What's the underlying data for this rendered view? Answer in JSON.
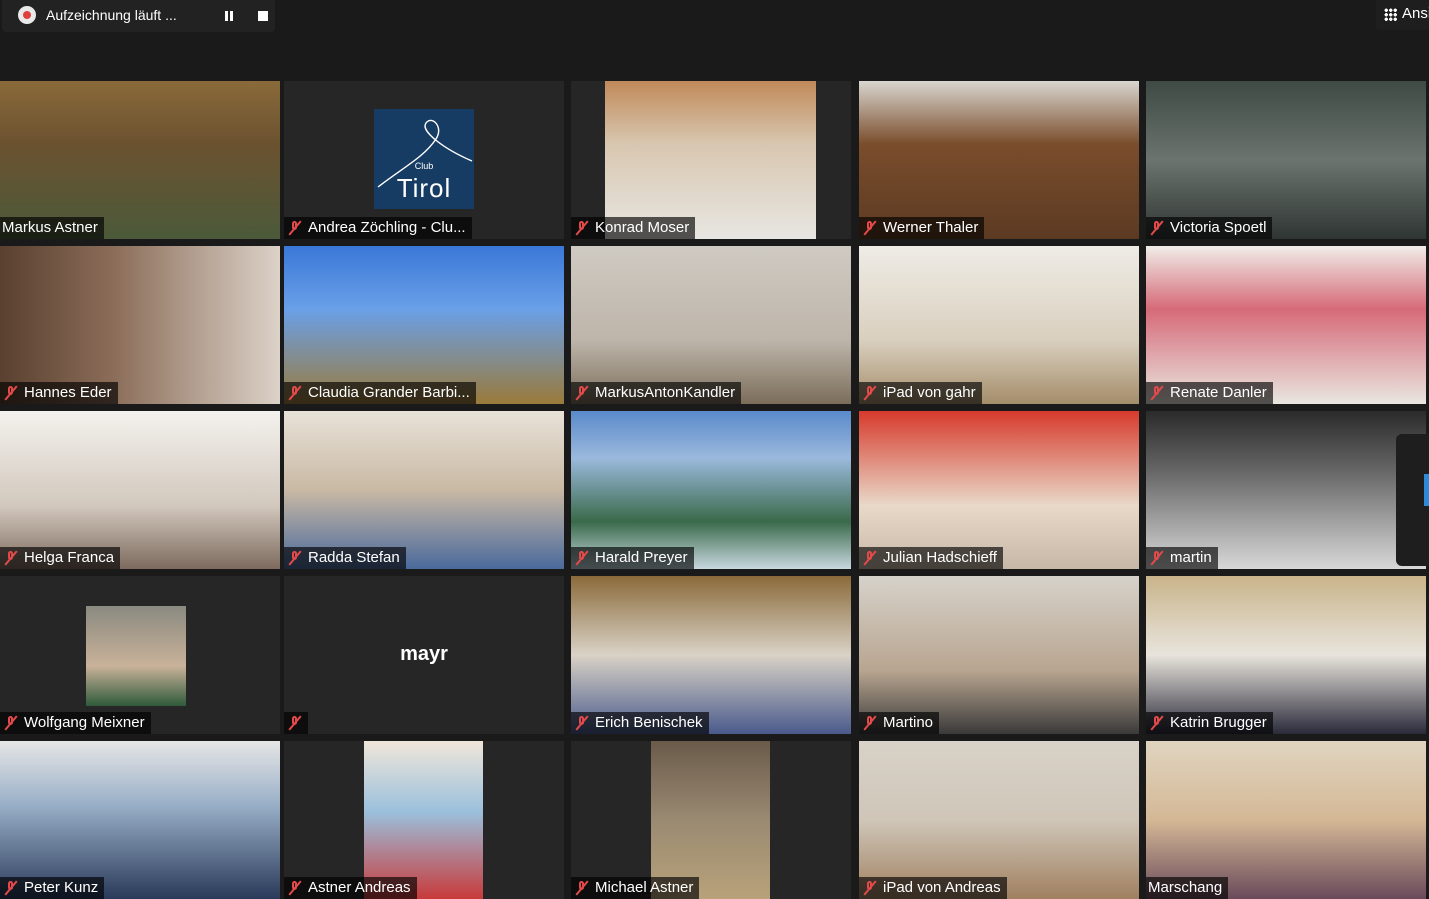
{
  "recording": {
    "label": "Aufzeichnung läuft ...",
    "pause_icon": "pause-icon",
    "stop_icon": "stop-icon"
  },
  "view_button": {
    "label": "Ansi",
    "icon": "grid-icon"
  },
  "colors": {
    "background": "#1a1a1a",
    "active_speaker_border": "#f7f08a",
    "muted_icon": "#e54a4a",
    "tile": "#262626"
  },
  "participants": [
    {
      "name": "Markus Astner",
      "muted": false,
      "active": true
    },
    {
      "name": "Andrea Zöchling - Clu...",
      "muted": true,
      "logo": "Tirol",
      "logo_sub": "Club"
    },
    {
      "name": "Konrad Moser",
      "muted": true
    },
    {
      "name": "Werner Thaler",
      "muted": true
    },
    {
      "name": "Victoria Spoetl",
      "muted": true
    },
    {
      "name": "Hannes Eder",
      "muted": true
    },
    {
      "name": "Claudia Grander Barbi...",
      "muted": true
    },
    {
      "name": "MarkusAntonKandler",
      "muted": true
    },
    {
      "name": "iPad von gahr",
      "muted": true
    },
    {
      "name": "Renate Danler",
      "muted": true
    },
    {
      "name": "Helga Franca",
      "muted": true
    },
    {
      "name": "Radda Stefan",
      "muted": true
    },
    {
      "name": "Harald Preyer",
      "muted": true
    },
    {
      "name": "Julian Hadschieff",
      "muted": true
    },
    {
      "name": "martin",
      "muted": true
    },
    {
      "name": "Wolfgang Meixner",
      "muted": true
    },
    {
      "name": "",
      "muted": true,
      "video_off_name": "mayr"
    },
    {
      "name": "Erich Benischek",
      "muted": true
    },
    {
      "name": "Martino",
      "muted": true
    },
    {
      "name": "Katrin Brugger",
      "muted": true
    },
    {
      "name": "Peter Kunz",
      "muted": true
    },
    {
      "name": "Astner Andreas",
      "muted": true
    },
    {
      "name": "Michael Astner",
      "muted": true
    },
    {
      "name": "iPad von Andreas",
      "muted": true
    },
    {
      "name": "Marschang",
      "muted": false
    }
  ]
}
